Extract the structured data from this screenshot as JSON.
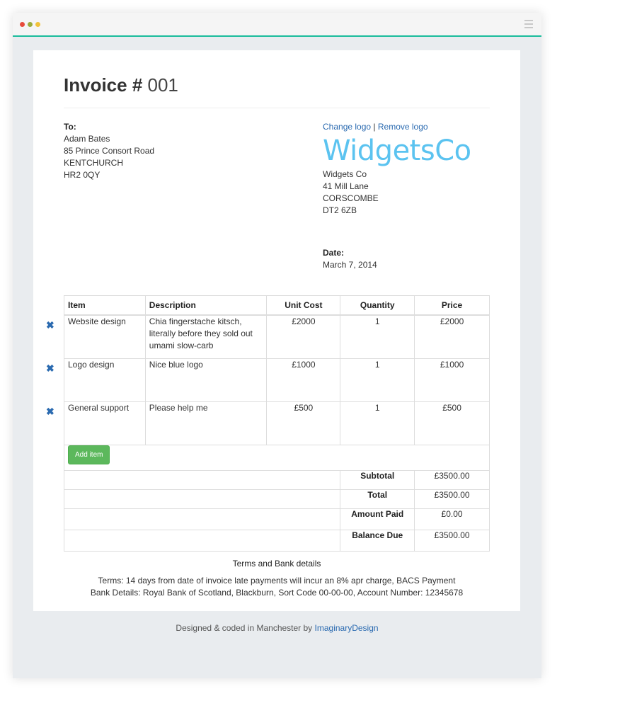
{
  "invoice": {
    "title_label": "Invoice #",
    "number": "001"
  },
  "to": {
    "label": "To:",
    "lines": [
      "Adam Bates",
      "85 Prince Consort Road",
      "KENTCHURCH",
      "HR2 0QY"
    ]
  },
  "logo": {
    "change_label": "Change logo",
    "separator": "|",
    "remove_label": "Remove logo",
    "text": "WidgetsCo",
    "color": "#5bc3f0"
  },
  "from": {
    "lines": [
      "Widgets Co",
      "41 Mill Lane",
      "CORSCOMBE",
      "DT2 6ZB"
    ]
  },
  "date": {
    "label": "Date:",
    "value": "March 7, 2014"
  },
  "table": {
    "headers": {
      "item": "Item",
      "description": "Description",
      "unit_cost": "Unit Cost",
      "quantity": "Quantity",
      "price": "Price"
    },
    "rows": [
      {
        "item": "Website design",
        "description": "Chia fingerstache kitsch, literally before they sold out umami slow-carb",
        "unit_cost": "£2000",
        "quantity": "1",
        "price": "£2000"
      },
      {
        "item": "Logo design",
        "description": "Nice blue logo",
        "unit_cost": "£1000",
        "quantity": "1",
        "price": "£1000"
      },
      {
        "item": "General support",
        "description": "Please help me",
        "unit_cost": "£500",
        "quantity": "1",
        "price": "£500"
      }
    ],
    "delete_icon": "✖",
    "add_item_label": "Add item"
  },
  "totals": {
    "subtotal_label": "Subtotal",
    "subtotal": "£3500.00",
    "total_label": "Total",
    "total": "£3500.00",
    "paid_label": "Amount Paid",
    "paid": "£0.00",
    "balance_label": "Balance Due",
    "balance": "£3500.00"
  },
  "terms": {
    "heading": "Terms and Bank details",
    "line1": "Terms: 14 days from date of invoice late payments will incur an 8% apr charge, BACS Payment",
    "line2": "Bank Details: Royal Bank of Scotland, Blackburn, Sort Code 00-00-00, Account Number: 12345678"
  },
  "footer": {
    "text": "Designed & coded in Manchester by",
    "link": "ImaginaryDesign"
  },
  "colors": {
    "accent": "#1abc9c",
    "link": "#2a6ab0",
    "button": "#5cb85c"
  }
}
